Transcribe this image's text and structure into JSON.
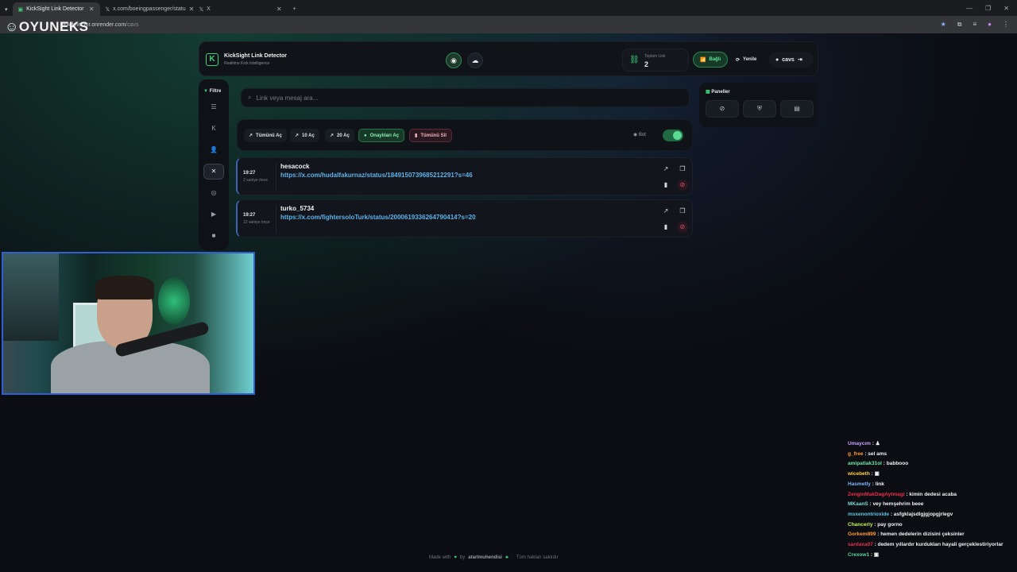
{
  "browser": {
    "tabs": [
      {
        "title": "KickSight Link Detector",
        "active": true
      },
      {
        "title": "x.com/boeingpassenger/statu",
        "active": false
      },
      {
        "title": "X",
        "active": false
      }
    ],
    "url_host": "linkdetector.onrender.com",
    "url_path": "/cavs"
  },
  "overlay": {
    "brand": "OYUNEKS"
  },
  "header": {
    "title": "KickSight Link Detector",
    "subtitle": "Realtime Kick Intelligence",
    "stat_label": "Toplam Link",
    "stat_value": "2",
    "status_label": "Bağlı",
    "refresh_label": "Yenile",
    "username": "cavs"
  },
  "sidebar": {
    "filter_label": "Filtre"
  },
  "search": {
    "placeholder": "Link veya mesaj ara..."
  },
  "actions": {
    "open_all": "Tümünü Aç",
    "open_10": "10 Aç",
    "open_20": "20 Aç",
    "open_approved": "Onaylıları Aç",
    "delete_all": "Tümünü Sil",
    "bot_label": "Bot",
    "bot_enabled": true
  },
  "links": [
    {
      "time": "19:27",
      "ago": "2 saniye önce",
      "user": "hesacock",
      "url": "https://x.com/hudalfakurnaz/status/1849150739685212291?s=46"
    },
    {
      "time": "19:27",
      "ago": "12 saniye önce",
      "user": "turko_5734",
      "url": "https://x.com/fightersoloTurk/status/2000619336264790414?s=20"
    }
  ],
  "panels": {
    "title": "Paneller"
  },
  "footer": {
    "made_with": "Made with",
    "by": "by",
    "author": "atarlmuhendisi",
    "rights": "Tüm hakları saklıdır"
  },
  "chat": [
    {
      "user": "Umaycım",
      "text": "♟",
      "color": "#c9a0ff"
    },
    {
      "user": "g_free",
      "text": "sel ams",
      "color": "#ff9a3c"
    },
    {
      "user": "amipatlak31ol",
      "text": "babbooo",
      "color": "#6ee7a8"
    },
    {
      "user": "wicebeth",
      "text": "▣",
      "color": "#ffd34d"
    },
    {
      "user": "Hasmetly",
      "text": "link",
      "color": "#7fb7ff"
    },
    {
      "user": "ZenginMakDagAytmagi",
      "text": "kimin dedesi acaba",
      "color": "#e8304a"
    },
    {
      "user": "MKaanS",
      "text": "vey hemşehrim beee",
      "color": "#7fd6d6"
    },
    {
      "user": "msxenontrioxide",
      "text": "asfgklajsdlgjgjopgjrlegv",
      "color": "#58c8e8"
    },
    {
      "user": "Chancerly",
      "text": "pay gorno",
      "color": "#c8f25a"
    },
    {
      "user": "Gorkem899",
      "text": "hemen dedelerin dizisini çeksinler",
      "color": "#ff9a3c"
    },
    {
      "user": "sardaxa07",
      "text": "dedem yıllardır kurdukları hayali gerçeklestiriyorlar",
      "color": "#e8304a"
    },
    {
      "user": "Crexow1",
      "text": "▣",
      "color": "#5ad6a0"
    }
  ]
}
